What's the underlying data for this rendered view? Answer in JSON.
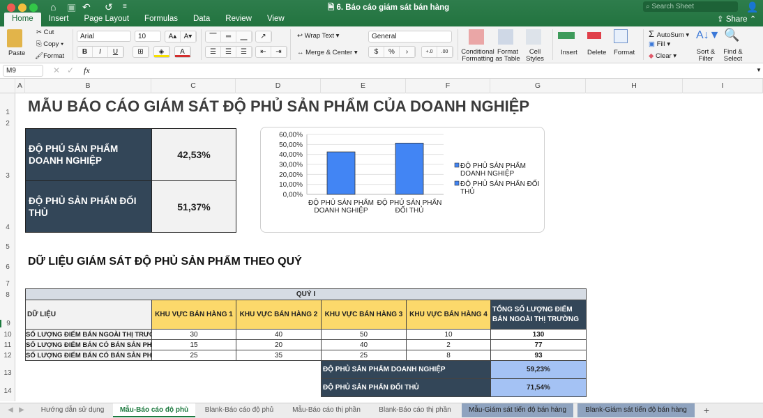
{
  "window": {
    "title": "6. Báo cáo giám sát bán hàng",
    "search_placeholder": "Search Sheet",
    "share_label": "Share"
  },
  "ribbon_tabs": [
    "Home",
    "Insert",
    "Page Layout",
    "Formulas",
    "Data",
    "Review",
    "View"
  ],
  "ribbon": {
    "paste": "Paste",
    "cut": "Cut",
    "copy": "Copy",
    "format_painter": "Format",
    "font_name": "Arial",
    "font_size": "10",
    "bold": "B",
    "italic": "I",
    "underline": "U",
    "wrap_text": "Wrap Text",
    "merge_center": "Merge & Center",
    "number_format": "General",
    "conditional_formatting": "Conditional Formatting",
    "format_as_table": "Format as Table",
    "cell_styles": "Cell Styles",
    "insert": "Insert",
    "delete": "Delete",
    "format": "Format",
    "autosum": "AutoSum",
    "fill": "Fill",
    "clear": "Clear",
    "sort_filter": "Sort & Filter",
    "find_select": "Find & Select"
  },
  "formula_bar": {
    "cell_ref": "M9",
    "fx": "fx",
    "value": ""
  },
  "columns": [
    "A",
    "B",
    "C",
    "D",
    "E",
    "F",
    "G",
    "H",
    "I"
  ],
  "rows": [
    "1",
    "2",
    "3",
    "4",
    "5",
    "6",
    "7",
    "8",
    "9",
    "10",
    "11",
    "12",
    "13",
    "14"
  ],
  "sheet": {
    "title": "MẪU BÁO CÁO GIÁM SÁT ĐỘ PHỦ SẢN PHẨM CỦA DOANH NGHIỆP",
    "kpis": [
      {
        "label": "ĐỘ PHỦ SẢN PHẨM DOANH NGHIỆP",
        "value": "42,53%"
      },
      {
        "label": "ĐỘ PHỦ SẢN PHẨN ĐỐI THỦ",
        "value": "51,37%"
      }
    ],
    "section_title": "DỮ LIỆU GIÁM SÁT ĐỘ PHỦ SẢN PHẨM THEO QUÝ",
    "table": {
      "quarter": "QUÝ I",
      "header_first": "DỮ LIỆU",
      "headers": [
        "KHU VỰC BÁN HÀNG 1",
        "KHU VỰC BÁN HÀNG 2",
        "KHU VỰC BÁN HÀNG 3",
        "KHU VỰC BÁN HÀNG 4"
      ],
      "total_header": "TỔNG SỐ LƯỢNG ĐIỂM BÁN NGOÀI THỊ TRƯỜNG",
      "rows": [
        {
          "label": "SỐ LƯỢNG ĐIỂM BÁN NGOÀI THỊ TRƯỜNG",
          "values": [
            "30",
            "40",
            "50",
            "10"
          ],
          "total": "130"
        },
        {
          "label": "SỐ LƯỢNG ĐIỂM BÁN CÓ BÁN SẢN PHẨM DOANH NGHIỆP",
          "values": [
            "15",
            "20",
            "40",
            "2"
          ],
          "total": "77"
        },
        {
          "label": "SỐ LƯỢNG ĐIỂM BÁN CÓ BÁN SẢN PHẨM ĐỐI THỦ",
          "values": [
            "25",
            "35",
            "25",
            "8"
          ],
          "total": "93"
        }
      ],
      "summary": [
        {
          "label": "ĐỘ PHỦ SẢN PHẨM DOANH NGHIỆP",
          "value": "59,23%"
        },
        {
          "label": "ĐỘ PHỦ SẢN PHẨN ĐỐI THỦ",
          "value": "71,54%"
        }
      ]
    }
  },
  "chart_data": {
    "type": "bar",
    "categories": [
      "ĐỘ PHỦ SẢN PHẨM DOANH NGHIỆP",
      "ĐỘ PHỦ SẢN PHẨN ĐỐI THỦ"
    ],
    "category_lines": [
      [
        "ĐỘ PHỦ SẢN PHẨM",
        "DOANH NGHIỆP"
      ],
      [
        "ĐỘ PHỦ SẢN PHẨN",
        "ĐỐI THỦ"
      ]
    ],
    "values": [
      42.53,
      51.37
    ],
    "ylim": [
      0,
      60
    ],
    "yticks": [
      "0,00%",
      "10,00%",
      "20,00%",
      "30,00%",
      "40,00%",
      "50,00%",
      "60,00%"
    ],
    "legend": [
      [
        "ĐỘ PHỦ SẢN PHẨM",
        "DOANH NGHIỆP"
      ],
      [
        "ĐỘ PHỦ SẢN PHẨN ĐỐI",
        "THỦ"
      ]
    ],
    "legend_position": "right",
    "grid": true,
    "color": "#4285f4",
    "title": "",
    "xlabel": "",
    "ylabel": ""
  },
  "sheet_tabs": [
    {
      "label": "Hướng dẫn sử dụng",
      "state": "normal"
    },
    {
      "label": "Mẫu-Báo cáo độ phủ",
      "state": "active"
    },
    {
      "label": "Blank-Báo cáo độ phủ",
      "state": "normal"
    },
    {
      "label": "Mẫu-Báo cáo thị phần",
      "state": "normal"
    },
    {
      "label": "Blank-Báo cáo thị phần",
      "state": "normal"
    },
    {
      "label": "Mẫu-Giám sát tiến độ bán hàng",
      "state": "colored"
    },
    {
      "label": "Blank-Giám sát tiến độ bán hàng",
      "state": "colored"
    }
  ]
}
